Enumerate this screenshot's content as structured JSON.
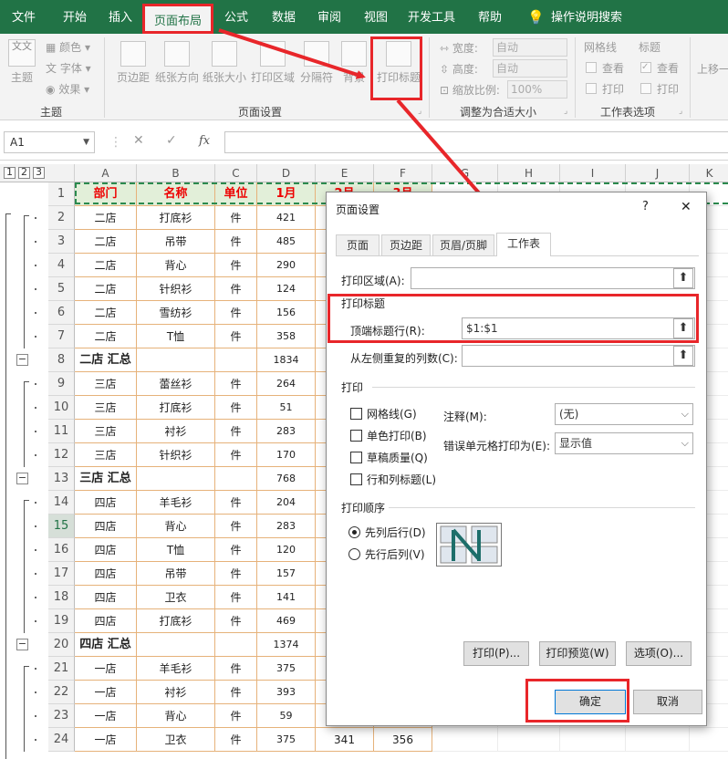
{
  "ribbon_tabs": [
    "文件",
    "开始",
    "插入",
    "页面布局",
    "公式",
    "数据",
    "审阅",
    "视图",
    "开发工具",
    "帮助"
  ],
  "active_tab": "页面布局",
  "tell_me": "操作说明搜索",
  "theme": {
    "main": "主题",
    "colors": "颜色",
    "fonts": "字体",
    "effects": "效果",
    "theme_icon_text": "文文",
    "group": "主题"
  },
  "page_setup_group": {
    "margins": "页边距",
    "orientation": "纸张方向",
    "size": "纸张大小",
    "print_area": "打印区域",
    "breaks": "分隔符",
    "background": "背景",
    "print_titles": "打印标题",
    "group": "页面设置"
  },
  "scale_group": {
    "width_label": "宽度:",
    "width_value": "自动",
    "height_label": "高度:",
    "height_value": "自动",
    "scale_label": "缩放比例:",
    "scale_value": "100%",
    "group": "调整为合适大小"
  },
  "sheet_options": {
    "gridlines": "网格线",
    "headings": "标题",
    "view1": "查看",
    "view2": "查看",
    "print1": "打印",
    "print2": "打印",
    "group": "工作表选项"
  },
  "arrange": {
    "bring_forward": "上移一"
  },
  "name_box": "A1",
  "fx_label": "fx",
  "column_headers": [
    "A",
    "B",
    "C",
    "D",
    "E",
    "F",
    "G",
    "H",
    "I",
    "J",
    "K"
  ],
  "outline_levels": [
    "1",
    "2",
    "3"
  ],
  "header_row": [
    "部门",
    "名称",
    "单位",
    "1月",
    "2月",
    "3月"
  ],
  "rows": [
    {
      "n": "2",
      "a": "二店",
      "b": "打底衫",
      "c": "件",
      "d": "421"
    },
    {
      "n": "3",
      "a": "二店",
      "b": "吊带",
      "c": "件",
      "d": "485"
    },
    {
      "n": "4",
      "a": "二店",
      "b": "背心",
      "c": "件",
      "d": "290"
    },
    {
      "n": "5",
      "a": "二店",
      "b": "针织衫",
      "c": "件",
      "d": "124"
    },
    {
      "n": "6",
      "a": "二店",
      "b": "雪纺衫",
      "c": "件",
      "d": "156"
    },
    {
      "n": "7",
      "a": "二店",
      "b": "T恤",
      "c": "件",
      "d": "358"
    },
    {
      "n": "8",
      "a": "二店 汇总",
      "b": "",
      "c": "",
      "d": "1834",
      "sum": true
    },
    {
      "n": "9",
      "a": "三店",
      "b": "蕾丝衫",
      "c": "件",
      "d": "264"
    },
    {
      "n": "10",
      "a": "三店",
      "b": "打底衫",
      "c": "件",
      "d": "51"
    },
    {
      "n": "11",
      "a": "三店",
      "b": "衬衫",
      "c": "件",
      "d": "283"
    },
    {
      "n": "12",
      "a": "三店",
      "b": "针织衫",
      "c": "件",
      "d": "170"
    },
    {
      "n": "13",
      "a": "三店 汇总",
      "b": "",
      "c": "",
      "d": "768",
      "sum": true
    },
    {
      "n": "14",
      "a": "四店",
      "b": "羊毛衫",
      "c": "件",
      "d": "204"
    },
    {
      "n": "15",
      "a": "四店",
      "b": "背心",
      "c": "件",
      "d": "283"
    },
    {
      "n": "16",
      "a": "四店",
      "b": "T恤",
      "c": "件",
      "d": "120"
    },
    {
      "n": "17",
      "a": "四店",
      "b": "吊带",
      "c": "件",
      "d": "157"
    },
    {
      "n": "18",
      "a": "四店",
      "b": "卫衣",
      "c": "件",
      "d": "141"
    },
    {
      "n": "19",
      "a": "四店",
      "b": "打底衫",
      "c": "件",
      "d": "469"
    },
    {
      "n": "20",
      "a": "四店 汇总",
      "b": "",
      "c": "",
      "d": "1374",
      "sum": true
    },
    {
      "n": "21",
      "a": "一店",
      "b": "羊毛衫",
      "c": "件",
      "d": "375"
    },
    {
      "n": "22",
      "a": "一店",
      "b": "衬衫",
      "c": "件",
      "d": "393"
    },
    {
      "n": "23",
      "a": "一店",
      "b": "背心",
      "c": "件",
      "d": "59"
    },
    {
      "n": "24",
      "a": "一店",
      "b": "卫衣",
      "c": "件",
      "d": "375",
      "e": "341",
      "f": "356"
    }
  ],
  "dialog": {
    "title": "页面设置",
    "help": "?",
    "close": "✕",
    "tabs": [
      "页面",
      "页边距",
      "页眉/页脚",
      "工作表"
    ],
    "print_area_label": "打印区域(A):",
    "print_titles_section": "打印标题",
    "rows_repeat_label": "顶端标题行(R):",
    "rows_repeat_value": "$1:$1",
    "cols_repeat_label": "从左侧重复的列数(C):",
    "print_section": "打印",
    "gridlines": "网格线(G)",
    "bw": "单色打印(B)",
    "draft": "草稿质量(Q)",
    "row_col_headings": "行和列标题(L)",
    "comments_label": "注释(M):",
    "comments_value": "(无)",
    "errors_label": "错误单元格打印为(E):",
    "errors_value": "显示值",
    "order_section": "打印顺序",
    "down_then_over": "先列后行(D)",
    "over_then_down": "先行后列(V)",
    "print_btn": "打印(P)...",
    "preview_btn": "打印预览(W)",
    "options_btn": "选项(O)...",
    "ok_btn": "确定",
    "cancel_btn": "取消"
  },
  "colors": {
    "excel_green": "#217346",
    "highlight_red": "#e8262a",
    "header_fill": "#e2efd9",
    "header_text": "#e00000"
  }
}
